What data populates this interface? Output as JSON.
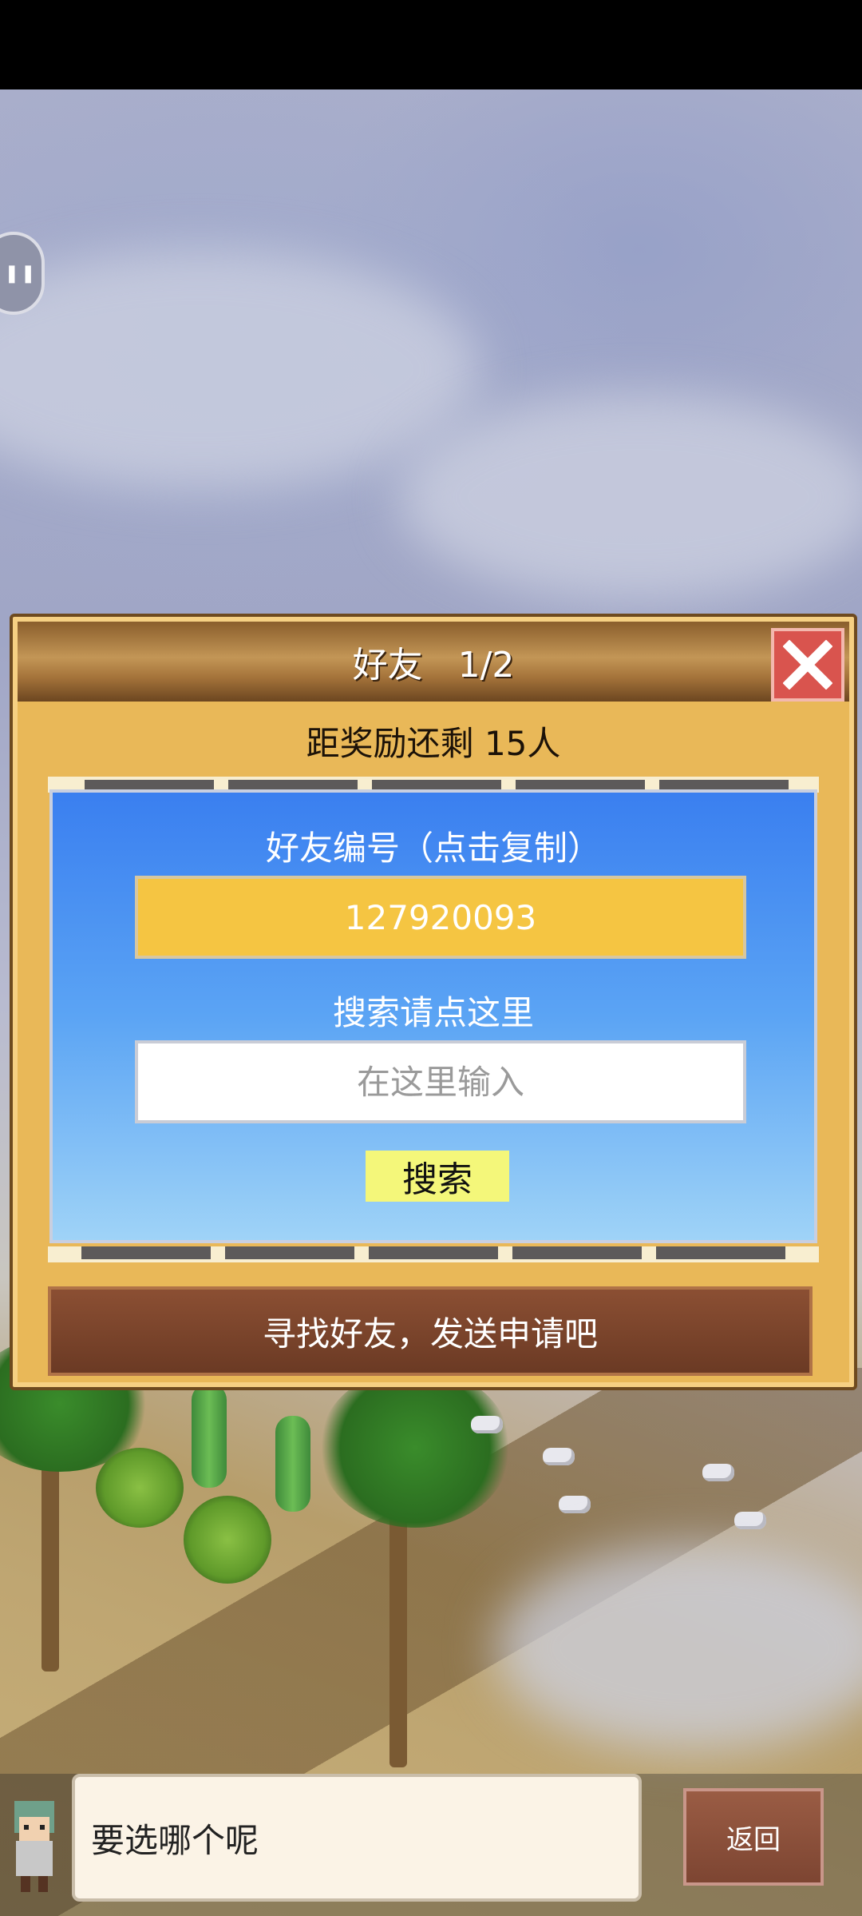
{
  "dialog": {
    "title": "好友　1/2",
    "reward_text": "距奖励还剩 15人",
    "friend_id_label": "好友编号（点击复制）",
    "friend_id": "127920093",
    "search_label": "搜索请点这里",
    "search_placeholder": "在这里输入",
    "search_button": "搜索",
    "find_button": "寻找好友，发送申请吧"
  },
  "bottom": {
    "speech_text": "要选哪个呢",
    "back_button": "返回"
  },
  "colors": {
    "panel_blue": "#3a7ff0",
    "id_box_yellow": "#f5c542",
    "search_button_yellow": "#f4f77a",
    "close_red": "#d9544e"
  },
  "icons": [
    "close-icon",
    "arrow-left-icon",
    "arrow-right-icon",
    "pause-icon"
  ]
}
